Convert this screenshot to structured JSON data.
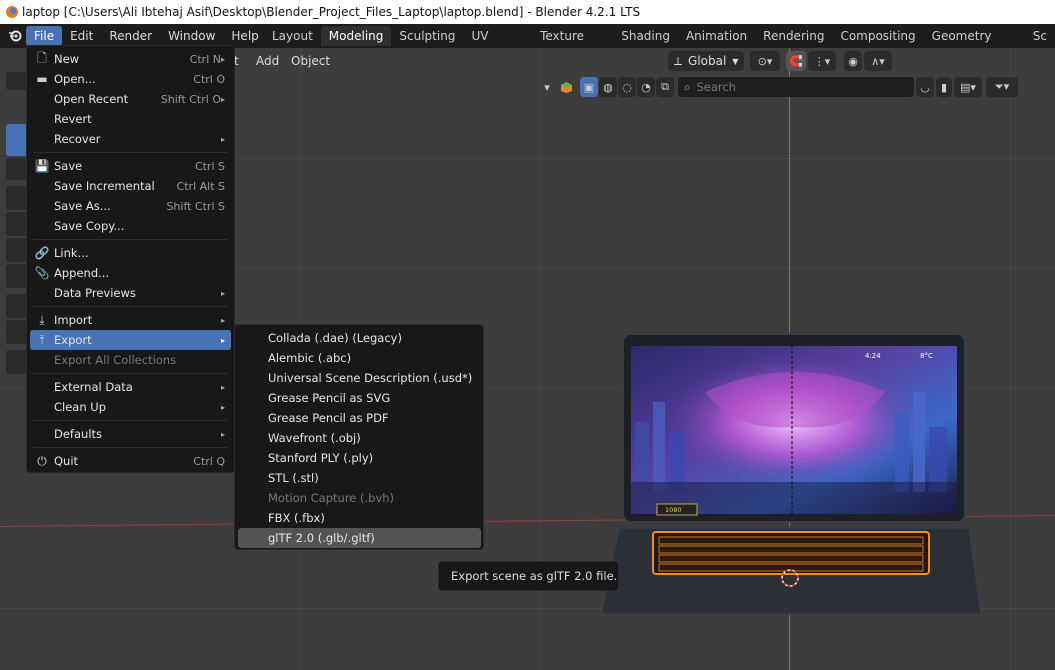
{
  "window": {
    "title": "laptop [C:\\Users\\Ali Ibtehaj Asif\\Desktop\\Blender_Project_Files_Laptop\\laptop.blend] - Blender 4.2.1 LTS"
  },
  "menubar": {
    "items": [
      "File",
      "Edit",
      "Render",
      "Window",
      "Help"
    ]
  },
  "workspaces": [
    "Layout",
    "Modeling",
    "Sculpting",
    "UV Editing",
    "Texture Paint",
    "Shading",
    "Animation",
    "Rendering",
    "Compositing",
    "Geometry Nodes",
    "Sc"
  ],
  "viewport_header": {
    "items": [
      "t",
      "Add",
      "Object"
    ],
    "orientation": "Global",
    "search_placeholder": "Search"
  },
  "file_menu": [
    {
      "icon": "new-file-icon",
      "label": "New",
      "shortcut": "Ctrl N",
      "arrow": true
    },
    {
      "icon": "folder-icon",
      "label": "Open...",
      "shortcut": "Ctrl O"
    },
    {
      "icon": "",
      "label": "Open Recent",
      "shortcut": "Shift Ctrl O",
      "arrow": true
    },
    {
      "icon": "",
      "label": "Revert",
      "shortcut": ""
    },
    {
      "icon": "",
      "label": "Recover",
      "shortcut": "",
      "arrow": true
    },
    {
      "icon": "save-icon",
      "label": "Save",
      "shortcut": "Ctrl S"
    },
    {
      "icon": "",
      "label": "Save Incremental",
      "shortcut": "Ctrl Alt S"
    },
    {
      "icon": "",
      "label": "Save As...",
      "shortcut": "Shift Ctrl S"
    },
    {
      "icon": "",
      "label": "Save Copy...",
      "shortcut": ""
    },
    {
      "icon": "link-icon",
      "label": "Link...",
      "shortcut": ""
    },
    {
      "icon": "append-icon",
      "label": "Append...",
      "shortcut": ""
    },
    {
      "icon": "",
      "label": "Data Previews",
      "shortcut": "",
      "arrow": true
    },
    {
      "icon": "import-icon",
      "label": "Import",
      "shortcut": "",
      "arrow": true
    },
    {
      "icon": "export-icon",
      "label": "Export",
      "shortcut": "",
      "arrow": true
    },
    {
      "icon": "",
      "label": "Export All Collections",
      "shortcut": "",
      "disabled": true
    },
    {
      "icon": "",
      "label": "External Data",
      "shortcut": "",
      "arrow": true
    },
    {
      "icon": "",
      "label": "Clean Up",
      "shortcut": "",
      "arrow": true
    },
    {
      "icon": "",
      "label": "Defaults",
      "shortcut": "",
      "arrow": true
    },
    {
      "icon": "power-icon",
      "label": "Quit",
      "shortcut": "Ctrl Q"
    }
  ],
  "export_menu": [
    {
      "label": "Collada (.dae) (Legacy)"
    },
    {
      "label": "Alembic (.abc)"
    },
    {
      "label": "Universal Scene Description (.usd*)"
    },
    {
      "label": "Grease Pencil as SVG"
    },
    {
      "label": "Grease Pencil as PDF"
    },
    {
      "label": "Wavefront (.obj)"
    },
    {
      "label": "Stanford PLY (.ply)"
    },
    {
      "label": "STL (.stl)"
    },
    {
      "label": "Motion Capture (.bvh)",
      "disabled": true
    },
    {
      "label": "FBX (.fbx)"
    },
    {
      "label": "glTF 2.0 (.glb/.gltf)",
      "hover": true
    }
  ],
  "tooltip": {
    "text": "Export scene as glTF 2.0 file."
  },
  "laptop_screen": {
    "time": "4:24",
    "temp": "8°C",
    "badge": "1080"
  }
}
